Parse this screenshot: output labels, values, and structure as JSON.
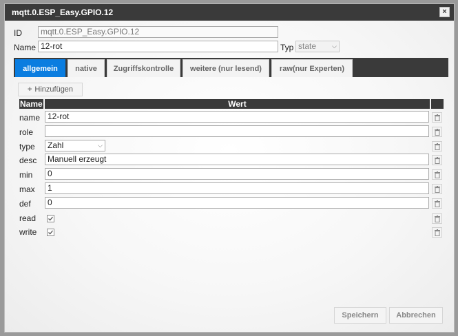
{
  "dialog": {
    "title": "mqtt.0.ESP_Easy.GPIO.12",
    "close_symbol": "×"
  },
  "header": {
    "id_label": "ID",
    "id_value": "mqtt.0.ESP_Easy.GPIO.12",
    "name_label": "Name",
    "name_value": "12-rot",
    "typ_label": "Typ",
    "typ_value": "state"
  },
  "tabs": [
    {
      "label": "allgemein",
      "active": true
    },
    {
      "label": "native",
      "active": false
    },
    {
      "label": "Zugriffskontrolle",
      "active": false
    },
    {
      "label": "weitere (nur lesend)",
      "active": false
    },
    {
      "label": "raw(nur Experten)",
      "active": false
    }
  ],
  "add_button": {
    "icon": "plus-icon",
    "label": "Hinzufügen"
  },
  "table": {
    "col_name": "Name",
    "col_value": "Wert",
    "rows": [
      {
        "name": "name",
        "kind": "text",
        "value": "12-rot"
      },
      {
        "name": "role",
        "kind": "text",
        "value": ""
      },
      {
        "name": "type",
        "kind": "select",
        "value": "Zahl"
      },
      {
        "name": "desc",
        "kind": "text",
        "value": "Manuell erzeugt"
      },
      {
        "name": "min",
        "kind": "text",
        "value": "0"
      },
      {
        "name": "max",
        "kind": "text",
        "value": "1"
      },
      {
        "name": "def",
        "kind": "text",
        "value": "0"
      },
      {
        "name": "read",
        "kind": "checkbox",
        "checked": true
      },
      {
        "name": "write",
        "kind": "checkbox",
        "checked": true
      }
    ]
  },
  "footer": {
    "save_label": "Speichern",
    "cancel_label": "Abbrechen"
  },
  "colors": {
    "accent": "#0a7de0",
    "titlebar": "#3a3a3a"
  }
}
